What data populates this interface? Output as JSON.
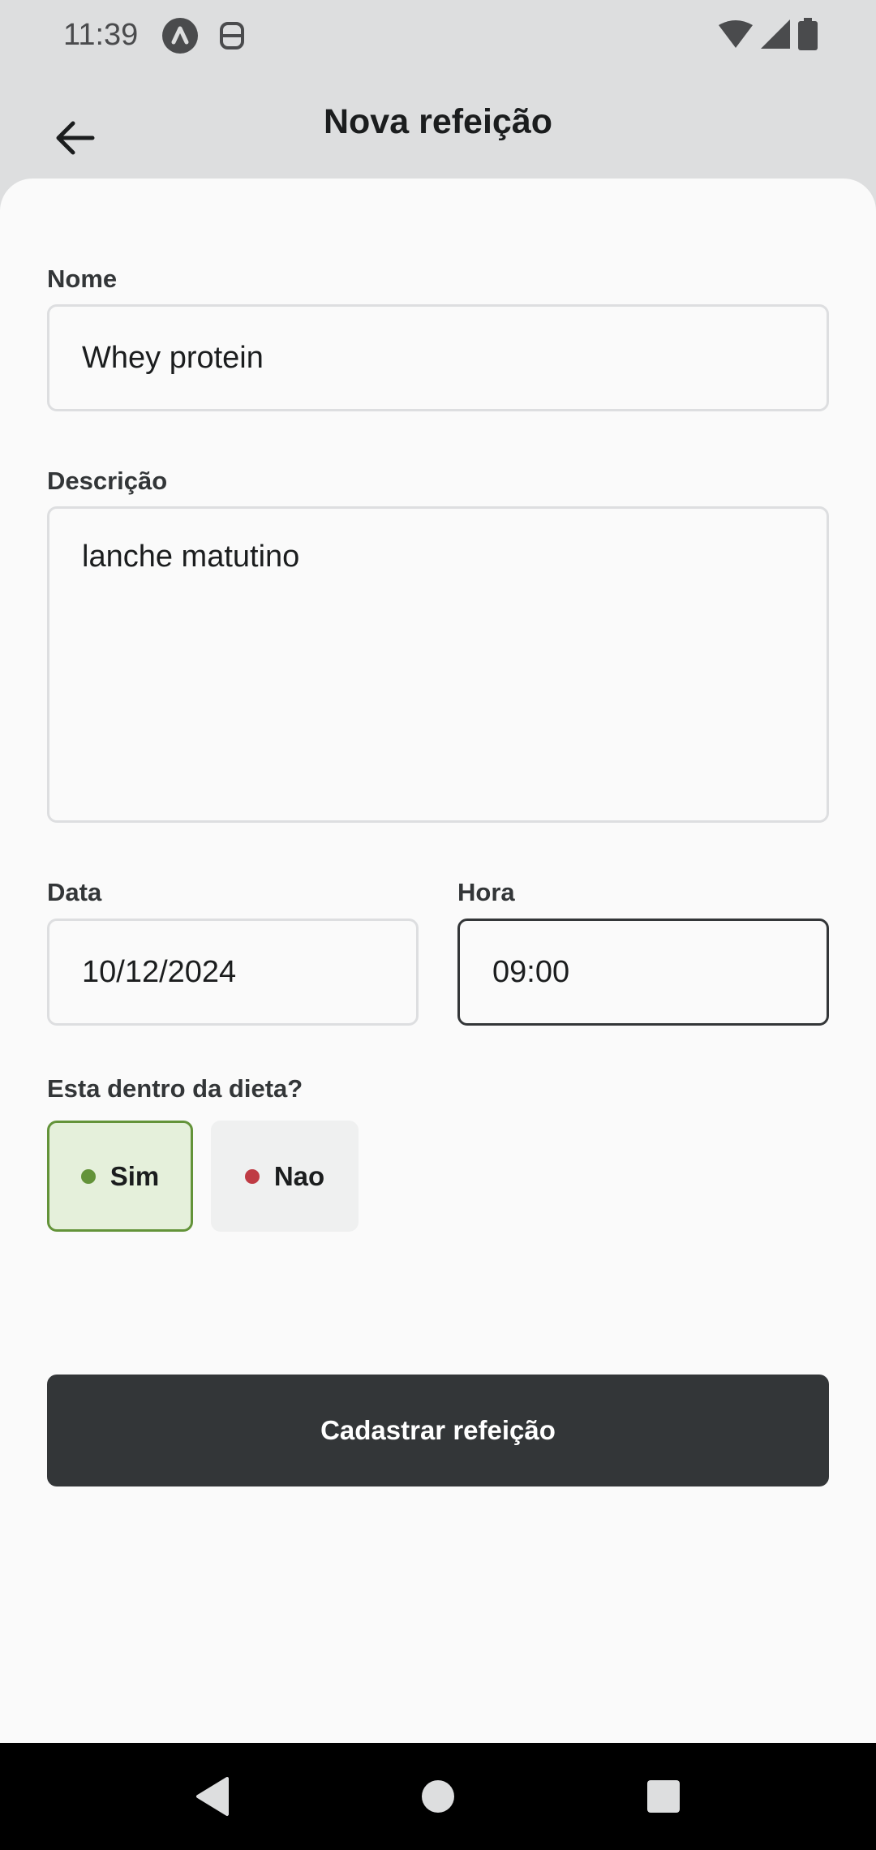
{
  "status_bar": {
    "time": "11:39",
    "icons": [
      "app-a-icon",
      "app-s-icon",
      "wifi-icon",
      "signal-icon",
      "battery-icon"
    ]
  },
  "header": {
    "title": "Nova refeição",
    "back_icon": "arrow-left-icon"
  },
  "form": {
    "name": {
      "label": "Nome",
      "value": "Whey protein"
    },
    "description": {
      "label": "Descrição",
      "value": "lanche matutino"
    },
    "date": {
      "label": "Data",
      "value": "10/12/2024"
    },
    "time": {
      "label": "Hora",
      "value": "09:00"
    },
    "diet": {
      "label": "Esta dentro da dieta?",
      "options": [
        {
          "label": "Sim",
          "selected": true,
          "color": "#639339"
        },
        {
          "label": "Nao",
          "selected": false,
          "color": "#BF3B44"
        }
      ]
    }
  },
  "submit": {
    "label": "Cadastrar refeição"
  },
  "colors": {
    "accent_dark": "#333638",
    "green": "#639339",
    "red": "#BF3B44"
  },
  "nav_bar": {
    "icons": [
      "back-triangle-icon",
      "home-circle-icon",
      "recents-square-icon"
    ]
  }
}
